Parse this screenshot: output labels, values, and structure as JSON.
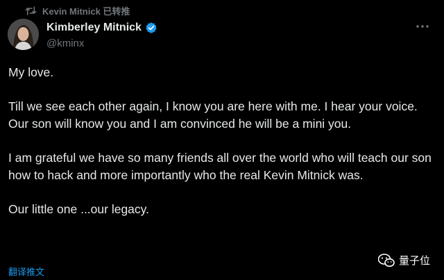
{
  "retweet": {
    "icon": "retweet-icon",
    "label": "Kevin Mitnick 已转推"
  },
  "author": {
    "display_name": "Kimberley Mitnick",
    "handle": "@kminx",
    "verified_icon": "verified-badge-icon",
    "avatar": "avatar"
  },
  "more_icon": "more-options-icon",
  "tweet": {
    "greeting": "My love.",
    "paragraph1_line1": "Till we see each other again, I know you are here with me. I hear your voice.",
    "paragraph1_line2": "Our son will know you and I am convinced he will be a mini you.",
    "paragraph2": "I am grateful we have so many friends all over the world who will teach our son how to hack and more importantly who the real Kevin Mitnick was.",
    "closing": "Our little one ...our legacy."
  },
  "translate_label": "翻译推文",
  "watermark": {
    "icon": "wechat-icon",
    "label": "量子位"
  },
  "colors": {
    "background": "#000000",
    "text": "#e7e9ea",
    "muted": "#71767b",
    "accent": "#1d9bf0"
  }
}
